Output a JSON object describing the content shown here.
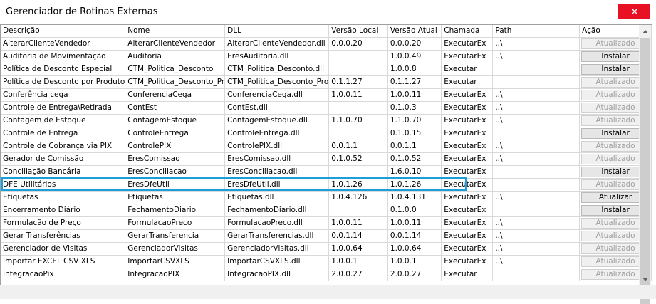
{
  "window": {
    "title": "Gerenciador de Rotinas Externas"
  },
  "columns": [
    "Descrição",
    "Nome",
    "DLL",
    "Versão Local",
    "Versão Atual",
    "Chamada",
    "Path",
    "Ação"
  ],
  "rows": [
    {
      "descricao": "AlterarClienteVendedor",
      "nome": "AlterarClienteVendedor",
      "dll": "AlterarClienteVendedor.dll",
      "versao_local": "0.0.0.20",
      "versao_atual": "0.0.0.20",
      "chamada": "ExecutarEx",
      "path": "..\\",
      "acao": "Atualizado",
      "acao_enabled": false
    },
    {
      "descricao": "Auditoria de Movimentação",
      "nome": "Auditoria",
      "dll": "EresAuditoria.dll",
      "versao_local": "",
      "versao_atual": "1.0.0.49",
      "chamada": "ExecutarEx",
      "path": "..\\",
      "acao": "Instalar",
      "acao_enabled": true
    },
    {
      "descricao": "Política de Desconto Especial",
      "nome": "CTM_Politica_Desconto",
      "dll": "CTM_Politica_Desconto.dll",
      "versao_local": "",
      "versao_atual": "1.0.0.8",
      "chamada": "Executar",
      "path": "",
      "acao": "Instalar",
      "acao_enabled": true
    },
    {
      "descricao": "Política de Desconto por Produto",
      "nome": "CTM_Politica_Desconto_Pr",
      "dll": "CTM_Politica_Desconto_Pro",
      "versao_local": "0.1.1.27",
      "versao_atual": "0.1.1.27",
      "chamada": "Executar",
      "path": "",
      "acao": "Atualizado",
      "acao_enabled": false
    },
    {
      "descricao": "Conferência cega",
      "nome": "ConferenciaCega",
      "dll": "ConferenciaCega.dll",
      "versao_local": "1.0.0.11",
      "versao_atual": "1.0.0.11",
      "chamada": "ExecutarEx",
      "path": "..\\",
      "acao": "Atualizado",
      "acao_enabled": false
    },
    {
      "descricao": "Controle de Entrega\\Retirada",
      "nome": "ContEst",
      "dll": "ContEst.dll",
      "versao_local": "",
      "versao_atual": "0.1.0.3",
      "chamada": "ExecutarEx",
      "path": "..\\",
      "acao": "Atualizado",
      "acao_enabled": false
    },
    {
      "descricao": "Contagem de Estoque",
      "nome": "ContagemEstoque",
      "dll": "ContagemEstoque.dll",
      "versao_local": "1.1.0.70",
      "versao_atual": "1.1.0.70",
      "chamada": "ExecutarEx",
      "path": "..\\",
      "acao": "Atualizado",
      "acao_enabled": false
    },
    {
      "descricao": "Controle de Entrega",
      "nome": "ControleEntrega",
      "dll": "ControleEntrega.dll",
      "versao_local": "",
      "versao_atual": "0.1.0.15",
      "chamada": "ExecutarEx",
      "path": "",
      "acao": "Instalar",
      "acao_enabled": true
    },
    {
      "descricao": "Controle de Cobrança via PIX",
      "nome": "ControlePIX",
      "dll": "ControlePIX.dll",
      "versao_local": "0.0.1.1",
      "versao_atual": "0.0.1.1",
      "chamada": "ExecutarEx",
      "path": "..\\",
      "acao": "Atualizado",
      "acao_enabled": false
    },
    {
      "descricao": "Gerador de Comissão",
      "nome": "EresComissao",
      "dll": "EresComissao.dll",
      "versao_local": "0.1.0.52",
      "versao_atual": "0.1.0.52",
      "chamada": "ExecutarEx",
      "path": "..\\",
      "acao": "Atualizado",
      "acao_enabled": false
    },
    {
      "descricao": "Conciliação Bancária",
      "nome": "EresConciliacao",
      "dll": "EresConciliacao.dll",
      "versao_local": "",
      "versao_atual": "1.6.0.10",
      "chamada": "ExecutarEx",
      "path": "",
      "acao": "Instalar",
      "acao_enabled": true
    },
    {
      "descricao": "DFE Utilitários",
      "nome": "EresDfeUtil",
      "dll": "EresDfeUtil.dll",
      "versao_local": "1.0.1.26",
      "versao_atual": "1.0.1.26",
      "chamada": "ExecutarEx",
      "path": "",
      "acao": "Atualizado",
      "acao_enabled": false
    },
    {
      "descricao": "Etiquetas",
      "nome": "Etiquetas",
      "dll": "Etiquetas.dll",
      "versao_local": "1.0.4.126",
      "versao_atual": "1.0.4.131",
      "chamada": "ExecutarEx",
      "path": "..\\",
      "acao": "Atualizar",
      "acao_enabled": true
    },
    {
      "descricao": "Encerramento Diário",
      "nome": "FechamentoDiario",
      "dll": "FechamentoDiario.dll",
      "versao_local": "",
      "versao_atual": "0.1.0.0",
      "chamada": "ExecutarEx",
      "path": "",
      "acao": "Instalar",
      "acao_enabled": true
    },
    {
      "descricao": "Formulação de Preço",
      "nome": "FormulacaoPreco",
      "dll": "FormulacaoPreco.dll",
      "versao_local": "1.0.0.11",
      "versao_atual": "1.0.0.11",
      "chamada": "ExecutarEx",
      "path": "..\\",
      "acao": "Atualizado",
      "acao_enabled": false
    },
    {
      "descricao": "Gerar Transferências",
      "nome": "GerarTransferencia",
      "dll": "GerarTransferencias.dll",
      "versao_local": "0.0.1.14",
      "versao_atual": "0.0.1.14",
      "chamada": "ExecutarEx",
      "path": "..\\",
      "acao": "Atualizado",
      "acao_enabled": false
    },
    {
      "descricao": "Gerenciador de Visitas",
      "nome": "GerenciadorVisitas",
      "dll": "GerenciadorVisitas.dll",
      "versao_local": "1.0.0.64",
      "versao_atual": "1.0.0.64",
      "chamada": "ExecutarEx",
      "path": "..\\",
      "acao": "Atualizado",
      "acao_enabled": false
    },
    {
      "descricao": "Importar EXCEL CSV XLS",
      "nome": "ImportarCSVXLS",
      "dll": "ImportarCSVXLS.dll",
      "versao_local": "1.0.0.1",
      "versao_atual": "1.0.0.1",
      "chamada": "ExecutarEx",
      "path": "..\\",
      "acao": "Atualizado",
      "acao_enabled": false
    },
    {
      "descricao": "IntegracaoPix",
      "nome": "IntegracaoPIX",
      "dll": "IntegracaoPIX.dll",
      "versao_local": "2.0.0.27",
      "versao_atual": "2.0.0.27",
      "chamada": "Executar",
      "path": "",
      "acao": "Atualizado",
      "acao_enabled": false
    }
  ],
  "highlighted_row": "DFE Utilitários",
  "colors": {
    "highlight": "#1a9fdc",
    "close": "#e81123"
  },
  "icons": {
    "close": "close-icon",
    "scroll_up": "chevron-up-icon",
    "scroll_down": "chevron-down-icon"
  }
}
